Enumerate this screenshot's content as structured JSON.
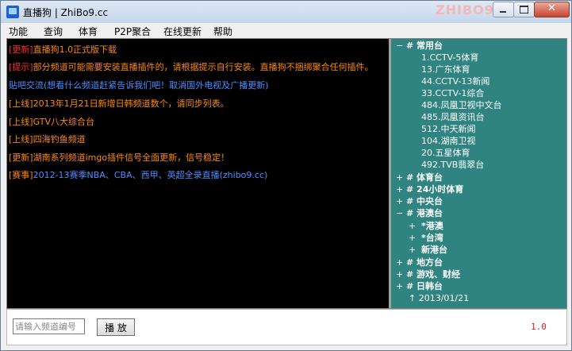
{
  "window": {
    "title": "直播狗 | ZhiBo9.cc",
    "watermark": "ZHIBO9",
    "controls": {
      "minimize": "minimize",
      "maximize": "maximize",
      "close": "✕"
    }
  },
  "menu": [
    "功能",
    "查询",
    "体育",
    "P2P聚合",
    "在线更新",
    "帮助"
  ],
  "news": [
    {
      "tag": "[更新]",
      "text": "直播狗1.0正式版下载",
      "tag_color": "red",
      "text_color": "orange"
    },
    {
      "tag": "[提示]",
      "text": "部分频道可能需要安装直播插件的，请根据提示自行安装。直播狗不捆绑聚合任何插件。",
      "tag_color": "red",
      "text_color": "orange"
    },
    {
      "tag": "",
      "text": "贴吧交流(想看什么频道赶紧告诉我们吧！取消国外电视及广播更新)",
      "tag_color": "blue",
      "text_color": "blue"
    },
    {
      "tag": "[上线]",
      "text": "2013年1月21日新增日韩频道数个，请同步列表。",
      "tag_color": "orange",
      "text_color": "orange"
    },
    {
      "tag": "[上线]",
      "text": "GTV八大综合台",
      "tag_color": "orange",
      "text_color": "orange"
    },
    {
      "tag": "[上线]",
      "text": "四海钓鱼频道",
      "tag_color": "orange",
      "text_color": "orange"
    },
    {
      "tag": "[更新]",
      "text": "湖南系列频道imgo插件信号全面更新，信号稳定！",
      "tag_color": "orange",
      "text_color": "orange"
    },
    {
      "tag": "[赛事]",
      "text": "2012-13赛季NBA、CBA、西甲、英超全录直播(zhibo9.cc)",
      "tag_color": "orange",
      "text_color": "blue"
    }
  ],
  "tree": {
    "common": {
      "expander": "−",
      "label": "# 常用台",
      "channels": [
        "1.CCTV-5体育",
        "13.广东体育",
        "44.CCTV-13新闻",
        "33.CCTV-1综合",
        "484.凤凰卫视中文台",
        "485.凤凰资讯台",
        "512.中天新闻",
        "104.湖南卫视",
        "20.五星体育",
        "492.TVB翡翠台"
      ]
    },
    "groups": [
      {
        "expander": "+",
        "label": "# 体育台"
      },
      {
        "expander": "+",
        "label": "# 24小时体育"
      },
      {
        "expander": "+",
        "label": "# 中央台"
      },
      {
        "expander": "−",
        "label": "# 港澳台"
      }
    ],
    "hk_sub": [
      {
        "expander": "+",
        "label": "*港澳"
      },
      {
        "expander": "+",
        "label": "*台湾"
      },
      {
        "expander": "+",
        "label": "新港台"
      }
    ],
    "more_groups": [
      {
        "expander": "+",
        "label": "# 地方台"
      },
      {
        "expander": "+",
        "label": "# 游戏、财经"
      },
      {
        "expander": "+",
        "label": "# 日韩台"
      }
    ],
    "date": "↑ 2013/01/21"
  },
  "status": {
    "input_placeholder": "请输入频道编号",
    "play_label": "播 放",
    "version": "1.0"
  },
  "colors": {
    "tree_bg": "#2f8481",
    "news_bg": "#000000",
    "version": "#e02020"
  }
}
